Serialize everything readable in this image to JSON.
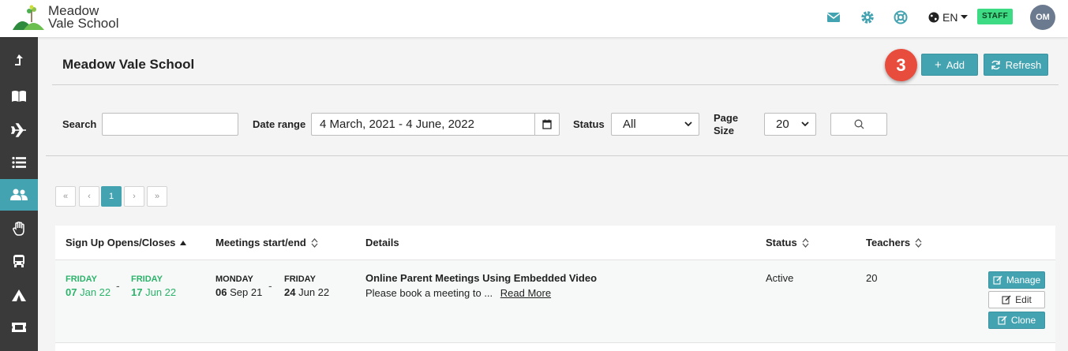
{
  "header": {
    "logo_line1": "Meadow",
    "logo_line2": "Vale School",
    "icons": [
      "mail-icon",
      "gear-icon",
      "lifebuoy-icon"
    ],
    "language": "EN",
    "role_badge": "STAFF",
    "avatar_initials": "OM",
    "accent": "#44a3b1"
  },
  "sidebar": {
    "items": [
      {
        "icon": "upload-arrow-icon",
        "active": false
      },
      {
        "icon": "book-icon",
        "active": false
      },
      {
        "icon": "plane-icon",
        "active": false
      },
      {
        "icon": "list-icon",
        "active": false
      },
      {
        "icon": "users-icon",
        "active": true
      },
      {
        "icon": "hand-icon",
        "active": false
      },
      {
        "icon": "bus-icon",
        "active": false
      },
      {
        "icon": "tent-icon",
        "active": false
      },
      {
        "icon": "ticket-icon",
        "active": false
      }
    ]
  },
  "main": {
    "title": "Meadow Vale School",
    "step_badge": "3",
    "add_label": "Add",
    "refresh_label": "Refresh"
  },
  "filters": {
    "search_label": "Search",
    "search_value": "",
    "date_range_label": "Date range",
    "date_range_value": "4 March, 2021 - 4 June, 2022",
    "status_label": "Status",
    "status_value": "All",
    "page_size_label_1": "Page",
    "page_size_label_2": "Size",
    "page_size_value": "20"
  },
  "pagination": {
    "first": "«",
    "prev": "‹",
    "current": "1",
    "next": "›",
    "last": "»"
  },
  "table": {
    "columns": {
      "signup": "Sign Up Opens/Closes",
      "meetings": "Meetings start/end",
      "details": "Details",
      "status": "Status",
      "teachers": "Teachers"
    },
    "rows": [
      {
        "signup_open_day": "FRIDAY",
        "signup_open_num": "07",
        "signup_open_rest": "Jan 22",
        "signup_close_day": "FRIDAY",
        "signup_close_num": "17",
        "signup_close_rest": "Jun 22",
        "meet_start_day": "MONDAY",
        "meet_start_num": "06",
        "meet_start_rest": "Sep 21",
        "meet_end_day": "FRIDAY",
        "meet_end_num": "24",
        "meet_end_rest": "Jun 22",
        "separator": "-",
        "title": "Online Parent Meetings Using Embedded Video",
        "summary": "Please book a meeting to ...",
        "read_more": "Read More",
        "status": "Active",
        "teachers": "20",
        "manage_label": "Manage",
        "edit_label": "Edit",
        "clone_label": "Clone"
      }
    ]
  }
}
